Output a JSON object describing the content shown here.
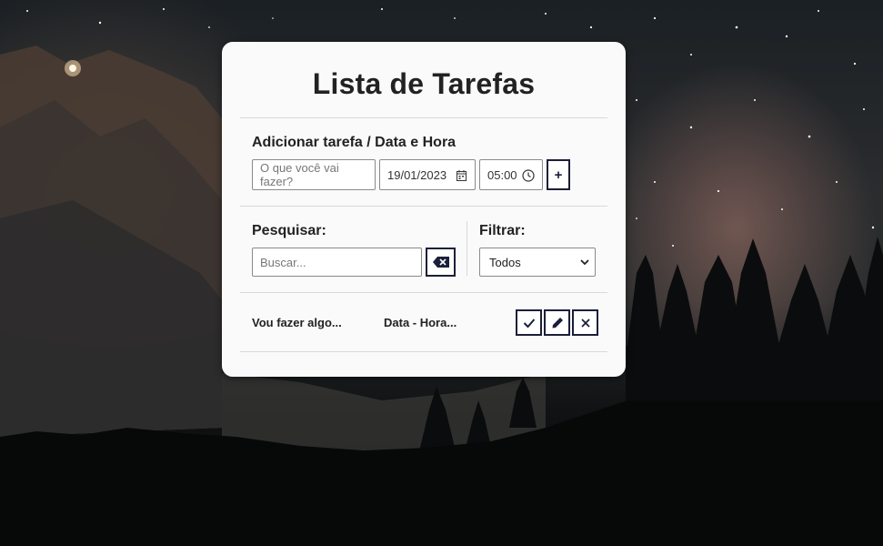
{
  "app": {
    "title": "Lista de Tarefas"
  },
  "add_task": {
    "label": "Adicionar tarefa / Data e Hora",
    "task_placeholder": "O que você vai fazer?",
    "date_value": "19/01/2023",
    "time_value": "05:00",
    "add_button": "+"
  },
  "search": {
    "label": "Pesquisar:",
    "placeholder": "Buscar...",
    "clear_icon": "backspace-icon"
  },
  "filter": {
    "label": "Filtrar:",
    "selected": "Todos"
  },
  "todos": [
    {
      "text": "Vou fazer algo...",
      "datetime": "Data - Hora...",
      "actions": [
        "check-icon",
        "pencil-icon",
        "close-icon"
      ]
    }
  ],
  "colors": {
    "accent": "#1b1f3a",
    "card": "#fafafa",
    "divider": "#d9d9d9"
  }
}
